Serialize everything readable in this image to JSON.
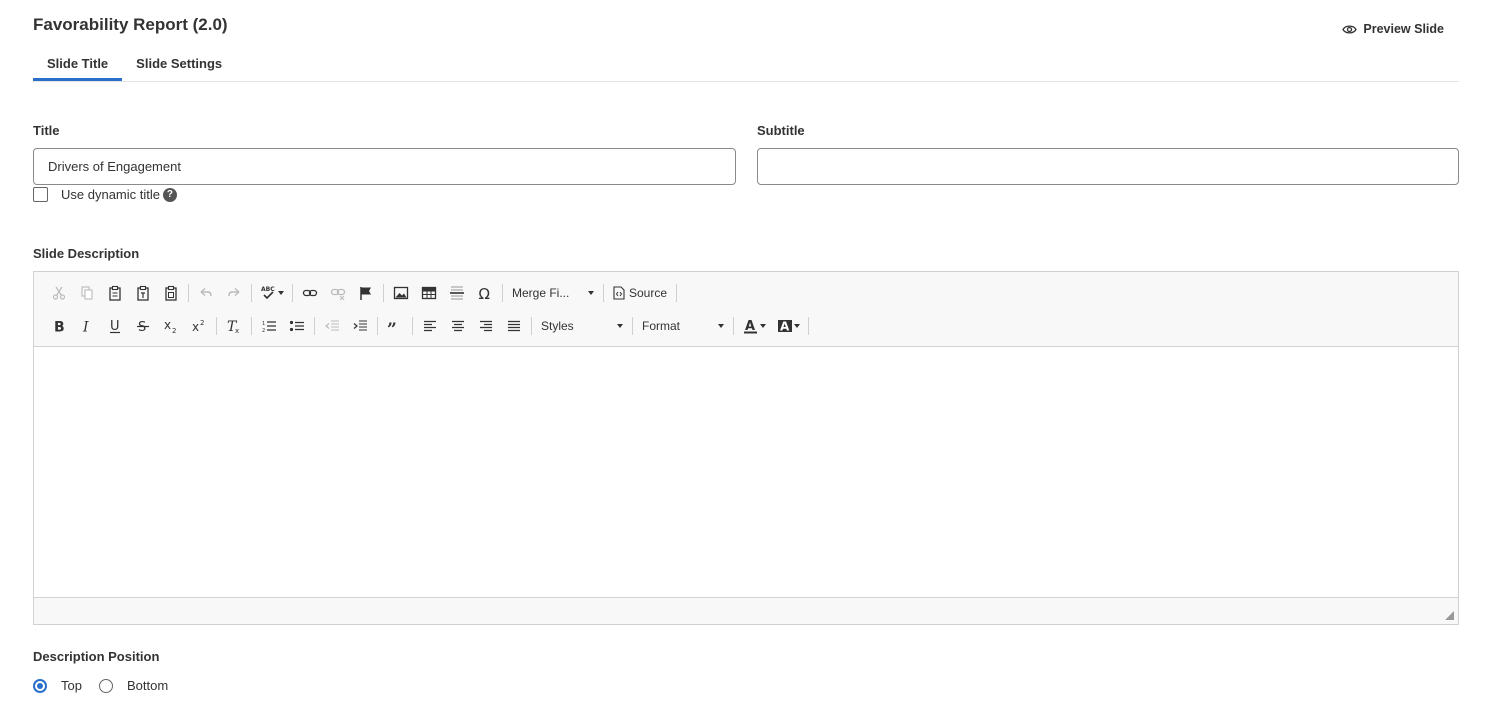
{
  "header": {
    "title": "Favorability Report (2.0)",
    "preview_label": "Preview Slide"
  },
  "tabs": [
    {
      "label": "Slide Title",
      "active": true
    },
    {
      "label": "Slide Settings",
      "active": false
    }
  ],
  "form": {
    "title_label": "Title",
    "title_value": "Drivers of Engagement",
    "subtitle_label": "Subtitle",
    "subtitle_value": "",
    "dynamic_title_label": "Use dynamic title",
    "help_glyph": "?",
    "description_label": "Slide Description",
    "position_label": "Description Position",
    "position_options": [
      {
        "label": "Top",
        "checked": true
      },
      {
        "label": "Bottom",
        "checked": false
      }
    ]
  },
  "editor": {
    "merge_fields_label": "Merge Fi...",
    "source_label": "Source",
    "styles_label": "Styles",
    "format_label": "Format"
  },
  "colors": {
    "accent": "#2a6fc9",
    "border": "#d1d1d1"
  }
}
